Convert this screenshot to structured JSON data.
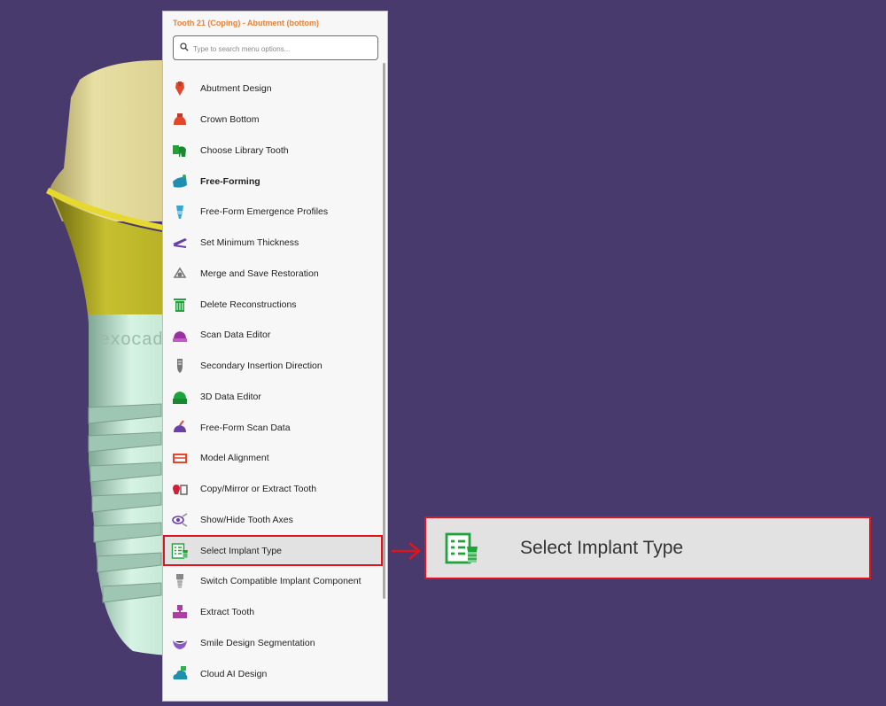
{
  "menu": {
    "title": "Tooth 21 (Coping) - Abutment (bottom)",
    "search_placeholder": "Type to search menu options...",
    "items": [
      {
        "label": "Abutment Design",
        "icon": "abutment-design-icon",
        "color": "#e0472b"
      },
      {
        "label": "Crown Bottom",
        "icon": "crown-bottom-icon",
        "color": "#e0472b"
      },
      {
        "label": "Choose Library Tooth",
        "icon": "library-tooth-icon",
        "color": "#1ea33a"
      },
      {
        "label": "Free-Forming",
        "icon": "free-forming-icon",
        "color": "#1f8fb0"
      },
      {
        "label": "Free-Form Emergence Profiles",
        "icon": "emergence-profiles-icon",
        "color": "#3aa6d0"
      },
      {
        "label": "Set Minimum Thickness",
        "icon": "minimum-thickness-icon",
        "color": "#6a3fa8"
      },
      {
        "label": "Merge and Save Restoration",
        "icon": "merge-save-icon",
        "color": "#777777"
      },
      {
        "label": "Delete Reconstructions",
        "icon": "trash-icon",
        "color": "#1ea33a"
      },
      {
        "label": "Scan Data Editor",
        "icon": "scan-data-editor-icon",
        "color": "#9a2fa0"
      },
      {
        "label": "Secondary Insertion Direction",
        "icon": "insertion-direction-icon",
        "color": "#777777"
      },
      {
        "label": "3D Data Editor",
        "icon": "3d-data-editor-icon",
        "color": "#1ea33a"
      },
      {
        "label": "Free-Form Scan Data",
        "icon": "free-form-scan-icon",
        "color": "#6a3fa8"
      },
      {
        "label": "Model Alignment",
        "icon": "model-alignment-icon",
        "color": "#e0472b"
      },
      {
        "label": "Copy/Mirror or Extract Tooth",
        "icon": "copy-mirror-icon",
        "color": "#d0203a"
      },
      {
        "label": "Show/Hide Tooth Axes",
        "icon": "tooth-axes-icon",
        "color": "#6a3fa8"
      },
      {
        "label": "Select Implant Type",
        "icon": "implant-type-icon",
        "color": "#1ea33a"
      },
      {
        "label": "Switch Compatible Implant Component",
        "icon": "implant-component-icon",
        "color": "#888888"
      },
      {
        "label": "Extract Tooth",
        "icon": "extract-tooth-icon",
        "color": "#b03aa8"
      },
      {
        "label": "Smile Design Segmentation",
        "icon": "smile-design-icon",
        "color": "#8a5ac8"
      },
      {
        "label": "Cloud AI Design",
        "icon": "cloud-ai-icon",
        "color": "#1f8fb0"
      }
    ],
    "bold_item": "Free-Forming",
    "selected_item": "Select Implant Type"
  },
  "zoom": {
    "label": "Select Implant Type",
    "icon": "implant-type-icon"
  },
  "background_text": "exocad",
  "colors": {
    "background": "#483a6c",
    "accent_title": "#e8823a",
    "highlight_border": "#e0141c",
    "selected_bg": "#e2e2e2"
  }
}
